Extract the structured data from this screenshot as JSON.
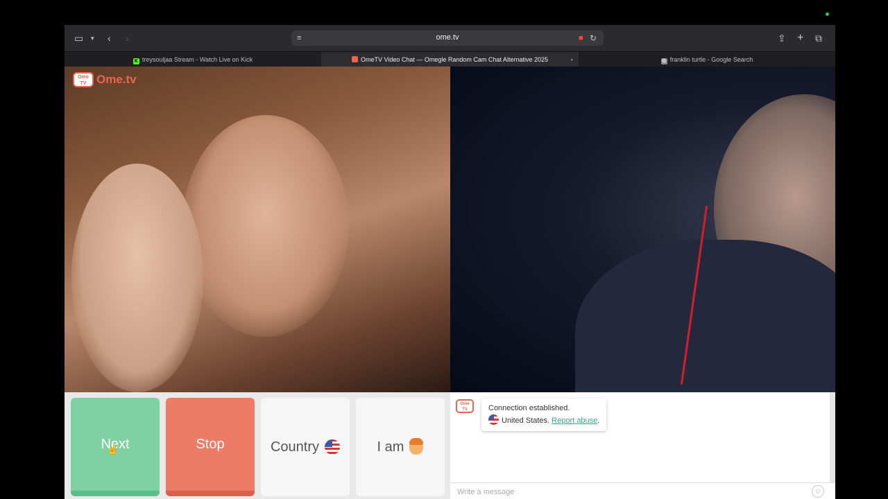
{
  "browser": {
    "url": "ome.tv",
    "tabs": [
      {
        "label": "treysouljaa Stream - Watch Live on Kick",
        "favicon": "K",
        "favicon_color": "#53fc18",
        "active": false
      },
      {
        "label": "OmeTV Video Chat — Omegle Random Cam Chat Alternative 2025",
        "favicon": "",
        "favicon_color": "#e8664f",
        "active": true
      },
      {
        "label": "franklin turtle - Google Search",
        "favicon": "G",
        "favicon_color": "#8e8e93",
        "active": false
      }
    ]
  },
  "app": {
    "logo_box": "Ome TV",
    "logo_text": "Ome.tv",
    "accent": "#e8664f"
  },
  "controls": {
    "next_label": "Next",
    "stop_label": "Stop",
    "country_label": "Country",
    "iam_label": "I am"
  },
  "chat": {
    "logo_box": "Ome TV",
    "status_line": "Connection established.",
    "country": "United States.",
    "report_link": "Report abuse",
    "report_suffix": ".",
    "input_placeholder": "Write a message"
  }
}
